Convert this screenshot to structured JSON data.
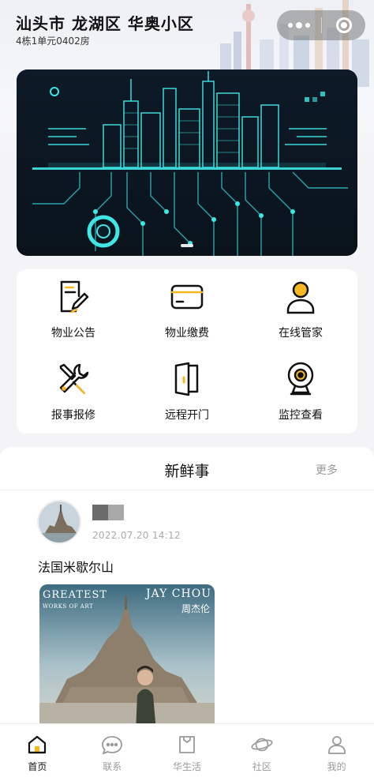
{
  "header": {
    "location_title": "汕头市 龙湖区 华奥小区",
    "room": "4栋1单元0402房"
  },
  "services": [
    {
      "label": "物业公告",
      "icon": "document-pen-icon"
    },
    {
      "label": "物业缴费",
      "icon": "card-icon"
    },
    {
      "label": "在线管家",
      "icon": "person-icon"
    },
    {
      "label": "报事报修",
      "icon": "tools-icon"
    },
    {
      "label": "远程开门",
      "icon": "door-icon"
    },
    {
      "label": "监控查看",
      "icon": "webcam-icon"
    }
  ],
  "news": {
    "title": "新鲜事",
    "more": "更多",
    "post": {
      "time": "2022.07.20 14:12",
      "text": "法国米歇尔山",
      "image_text": {
        "top_left": "GREATEST",
        "top_left_sub": "WORKS OF ART",
        "top_right": "JAY CHOU",
        "top_right_sub": "周杰伦"
      }
    }
  },
  "tabbar": [
    {
      "label": "首页",
      "icon": "home-icon",
      "active": true
    },
    {
      "label": "联系",
      "icon": "chat-icon",
      "active": false
    },
    {
      "label": "华生活",
      "icon": "shopping-bag-icon",
      "active": false
    },
    {
      "label": "社区",
      "icon": "planet-icon",
      "active": false
    },
    {
      "label": "我的",
      "icon": "user-icon",
      "active": false
    }
  ],
  "colors": {
    "banner_bg": "#0c1622",
    "banner_glow": "#3fe6e6",
    "active_tab": "#f5b820"
  }
}
